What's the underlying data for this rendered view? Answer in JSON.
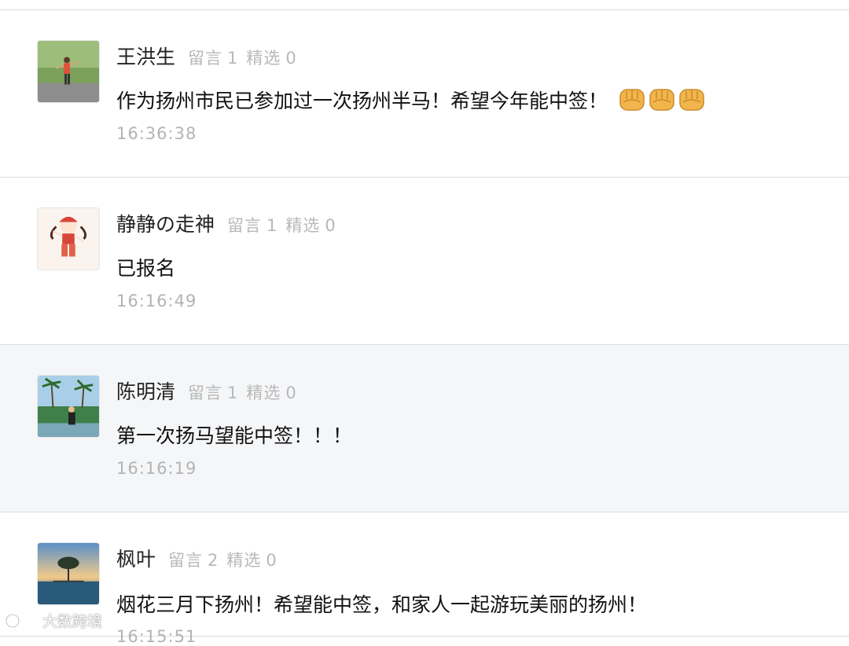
{
  "comments": [
    {
      "name": "王洪生",
      "liuyan_label": "留言",
      "liuyan_count": "1",
      "jingxuan_label": "精选",
      "jingxuan_count": "0",
      "content": "作为扬州市民已参加过一次扬州半马！希望今年能中签！",
      "emoji": "fist-emoji x3",
      "time": "16:36:38"
    },
    {
      "name": "静静の走神",
      "liuyan_label": "留言",
      "liuyan_count": "1",
      "jingxuan_label": "精选",
      "jingxuan_count": "0",
      "content": "已报名",
      "time": "16:16:49"
    },
    {
      "name": "陈明清",
      "liuyan_label": "留言",
      "liuyan_count": "1",
      "jingxuan_label": "精选",
      "jingxuan_count": "0",
      "content": "第一次扬马望能中签！！！",
      "time": "16:16:19"
    },
    {
      "name": "枫叶",
      "liuyan_label": "留言",
      "liuyan_count": "2",
      "jingxuan_label": "精选",
      "jingxuan_count": "0",
      "content": "烟花三月下扬州！希望能中签，和家人一起游玩美丽的扬州！",
      "time": "16:15:51"
    }
  ],
  "watermark": {
    "text": "大数跨境",
    "icon": "logo-icon"
  },
  "colors": {
    "shaded_row": "#f5f6f8",
    "meta_text": "#b8b8b8",
    "divider": "#dcdcdc"
  }
}
